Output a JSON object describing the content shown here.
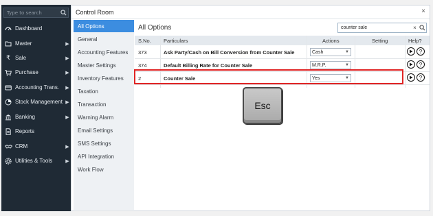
{
  "sidebar": {
    "search_placeholder": "Type to search",
    "items": [
      {
        "label": "Dashboard",
        "icon": "dashboard-icon",
        "has_arrow": false
      },
      {
        "label": "Master",
        "icon": "folder-icon",
        "has_arrow": true
      },
      {
        "label": "Sale",
        "icon": "rupee-icon",
        "has_arrow": true
      },
      {
        "label": "Purchase",
        "icon": "cart-icon",
        "has_arrow": true
      },
      {
        "label": "Accounting Trans.",
        "icon": "bank-card-icon",
        "has_arrow": true
      },
      {
        "label": "Stock Management",
        "icon": "pie-chart-icon",
        "has_arrow": true
      },
      {
        "label": "Banking",
        "icon": "bank-icon",
        "has_arrow": true
      },
      {
        "label": "Reports",
        "icon": "document-icon",
        "has_arrow": false
      },
      {
        "label": "CRM",
        "icon": "handshake-icon",
        "has_arrow": true
      },
      {
        "label": "Utilities & Tools",
        "icon": "tools-icon",
        "has_arrow": true
      }
    ]
  },
  "dialog": {
    "title": "Control Room",
    "close_symbol": "×",
    "options": [
      "All Options",
      "General",
      "Accounting Features",
      "Master Settings",
      "Inventory Features",
      "Taxation",
      "Transaction",
      "Warning Alarm",
      "Email Settings",
      "SMS Settings",
      "API Integration",
      "Work Flow"
    ],
    "active_option": "All Options",
    "content_title": "All Options",
    "filter_value": "counter sale",
    "filter_clear": "×",
    "columns": {
      "sno": "S.No.",
      "particulars": "Particulars",
      "actions": "Actions",
      "setting": "Setting",
      "help": "Help?"
    },
    "rows": [
      {
        "sno": "373",
        "particulars": "Ask Party/Cash on Bill Conversion from Counter Sale",
        "action": "Cash"
      },
      {
        "sno": "374",
        "particulars": "Default Billing Rate for Counter Sale",
        "action": "M.R.P."
      },
      {
        "sno": "2",
        "particulars": "Counter Sale",
        "action": "Yes"
      }
    ],
    "help_q": "?"
  },
  "overlay": {
    "key_label": "Esc"
  },
  "colors": {
    "sidebar_bg": "#1f2a35",
    "active_option": "#3c8de0",
    "highlight_border": "#e02424"
  }
}
